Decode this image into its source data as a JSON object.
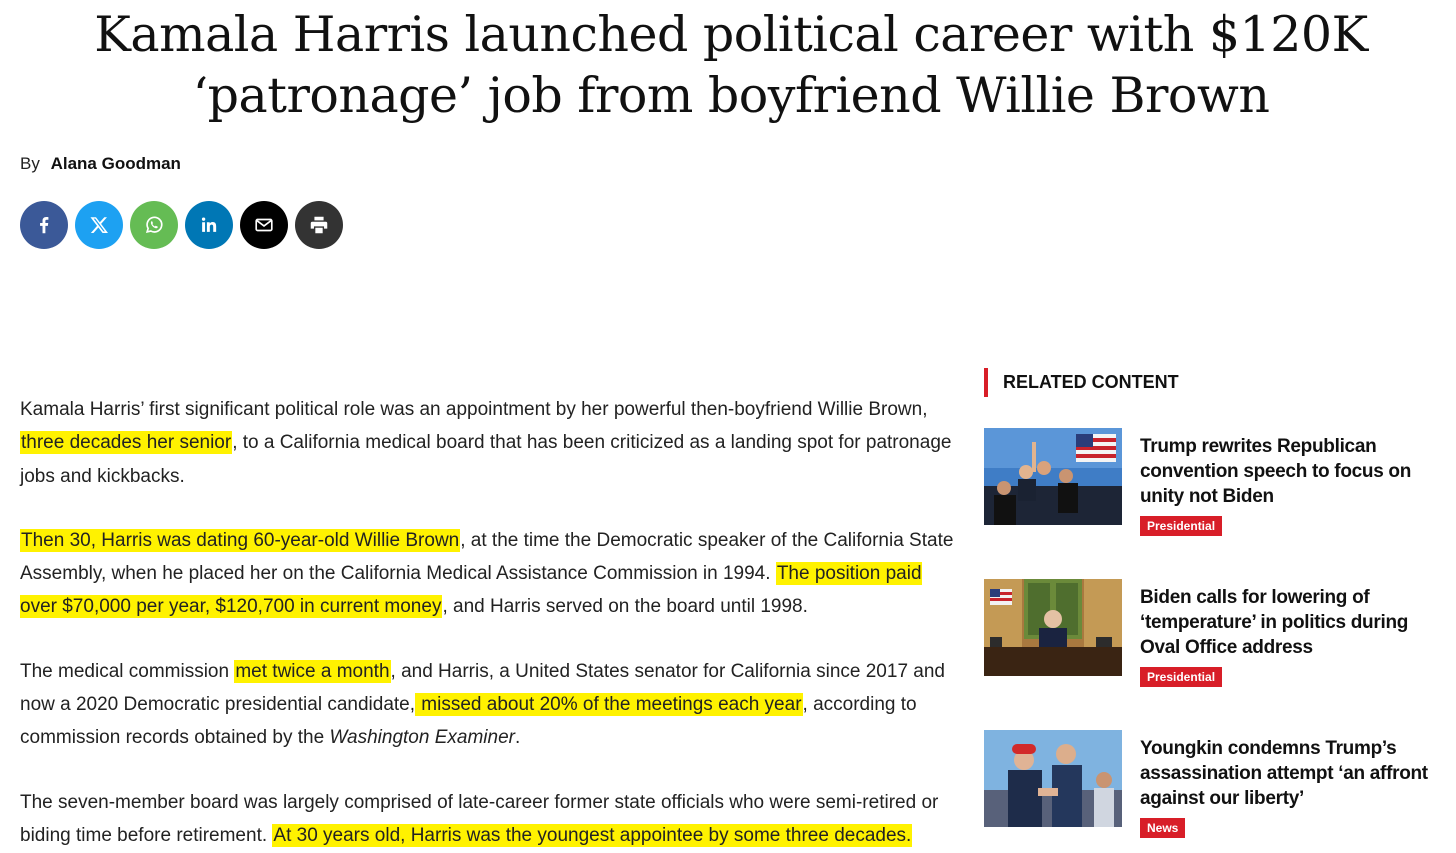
{
  "headline": {
    "line1": "Kamala Harris launched political career with $120K",
    "line2": "‘patronage’ job from boyfriend Willie Brown"
  },
  "byline": {
    "prefix": "By",
    "author": "Alana Goodman"
  },
  "share": {
    "buttons": [
      {
        "name": "facebook",
        "icon": "facebook-icon",
        "color": "#3b5998"
      },
      {
        "name": "x",
        "icon": "x-icon",
        "color": "#1da1f2"
      },
      {
        "name": "whatsapp",
        "icon": "whatsapp-icon",
        "color": "#65bc54"
      },
      {
        "name": "linkedin",
        "icon": "linkedin-icon",
        "color": "#0077b5"
      },
      {
        "name": "email",
        "icon": "email-icon",
        "color": "#000000"
      },
      {
        "name": "print",
        "icon": "print-icon",
        "color": "#333333"
      }
    ]
  },
  "article": {
    "p1": {
      "a": "Kamala Harris’ first significant political role was an appointment by her powerful then-boyfriend Willie Brown, ",
      "hl1": "three decades her senior",
      "b": ", to a California medical board that has been criticized as a landing spot for patronage jobs and kickbacks."
    },
    "p2": {
      "hl1": "Then 30, Harris was dating 60-year-old Willie Brown",
      "a": ", at the time the Democratic speaker of the California State Assembly, when he placed her on the California Medical Assistance Commission in 1994. ",
      "hl2": "The position paid over $70,000 per year, $120,700 in current money",
      "b": ", and Harris served on the board until 1998."
    },
    "p3": {
      "a": "The medical commission ",
      "hl1": "met twice a month",
      "b": ", and Harris, a United States senator for California since 2017 and now a 2020 Democratic presidential candidate,",
      "hl2": " missed about 20% of the meetings each year",
      "c": ", according to commission records obtained by the ",
      "em": "Washington Examiner",
      "d": "."
    },
    "p4": {
      "a": "The seven-member board was largely comprised of late-career former state officials who were semi-retired or biding time before retirement. ",
      "hl1": "At 30 years old, Harris was the youngest appointee by some three decades."
    },
    "highlight_color": "#fff200"
  },
  "related": {
    "header": "RELATED CONTENT",
    "accent_color": "#d81e28",
    "items": [
      {
        "title": "Trump rewrites Republican convention speech to focus on unity not Biden",
        "tag": "Presidential"
      },
      {
        "title": "Biden calls for lowering of ‘temperature’ in politics during Oval Office address",
        "tag": "Presidential"
      },
      {
        "title": "Youngkin condemns Trump’s assassination attempt ‘an affront against our liberty’",
        "tag": "News"
      }
    ]
  }
}
